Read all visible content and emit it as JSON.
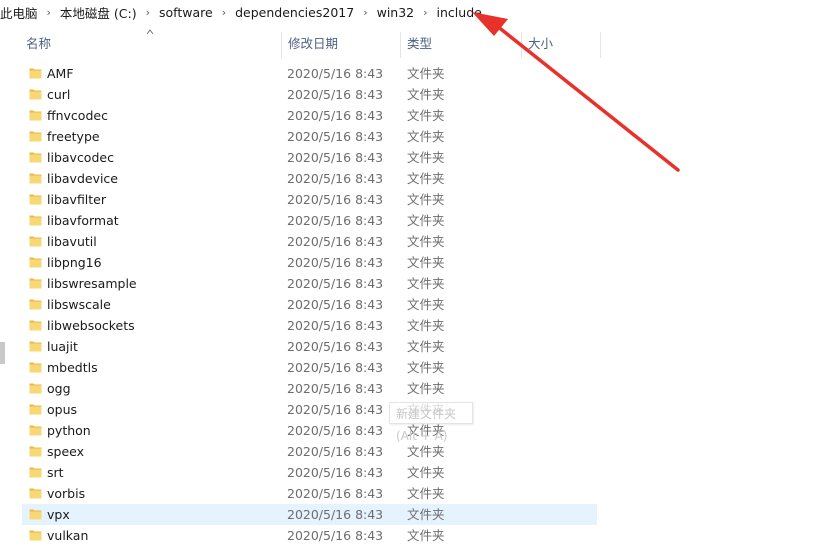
{
  "breadcrumb": [
    "此电脑",
    "本地磁盘 (C:)",
    "software",
    "dependencies2017",
    "win32",
    "include"
  ],
  "columns": {
    "name": "名称",
    "date": "修改日期",
    "type": "类型",
    "size": "大小"
  },
  "files": [
    {
      "name": "AMF",
      "date": "2020/5/16 8:43",
      "type": "文件夹"
    },
    {
      "name": "curl",
      "date": "2020/5/16 8:43",
      "type": "文件夹"
    },
    {
      "name": "ffnvcodec",
      "date": "2020/5/16 8:43",
      "type": "文件夹"
    },
    {
      "name": "freetype",
      "date": "2020/5/16 8:43",
      "type": "文件夹"
    },
    {
      "name": "libavcodec",
      "date": "2020/5/16 8:43",
      "type": "文件夹"
    },
    {
      "name": "libavdevice",
      "date": "2020/5/16 8:43",
      "type": "文件夹"
    },
    {
      "name": "libavfilter",
      "date": "2020/5/16 8:43",
      "type": "文件夹"
    },
    {
      "name": "libavformat",
      "date": "2020/5/16 8:43",
      "type": "文件夹"
    },
    {
      "name": "libavutil",
      "date": "2020/5/16 8:43",
      "type": "文件夹"
    },
    {
      "name": "libpng16",
      "date": "2020/5/16 8:43",
      "type": "文件夹"
    },
    {
      "name": "libswresample",
      "date": "2020/5/16 8:43",
      "type": "文件夹"
    },
    {
      "name": "libswscale",
      "date": "2020/5/16 8:43",
      "type": "文件夹"
    },
    {
      "name": "libwebsockets",
      "date": "2020/5/16 8:43",
      "type": "文件夹"
    },
    {
      "name": "luajit",
      "date": "2020/5/16 8:43",
      "type": "文件夹"
    },
    {
      "name": "mbedtls",
      "date": "2020/5/16 8:43",
      "type": "文件夹"
    },
    {
      "name": "ogg",
      "date": "2020/5/16 8:43",
      "type": "文件夹"
    },
    {
      "name": "opus",
      "date": "2020/5/16 8:43",
      "type": "文件夹"
    },
    {
      "name": "python",
      "date": "2020/5/16 8:43",
      "type": "文件夹"
    },
    {
      "name": "speex",
      "date": "2020/5/16 8:43",
      "type": "文件夹"
    },
    {
      "name": "srt",
      "date": "2020/5/16 8:43",
      "type": "文件夹"
    },
    {
      "name": "vorbis",
      "date": "2020/5/16 8:43",
      "type": "文件夹"
    },
    {
      "name": "vpx",
      "date": "2020/5/16 8:43",
      "type": "文件夹",
      "selected": true
    },
    {
      "name": "vulkan",
      "date": "2020/5/16 8:43",
      "type": "文件夹"
    }
  ],
  "tooltip": "新建文件夹 (Alt + A)",
  "colors": {
    "folder": "#f8d775",
    "folder_dark": "#e8b84a",
    "header_text": "#4d6082",
    "selection": "#e5f3ff",
    "annotation_arrow": "#e8312a"
  }
}
